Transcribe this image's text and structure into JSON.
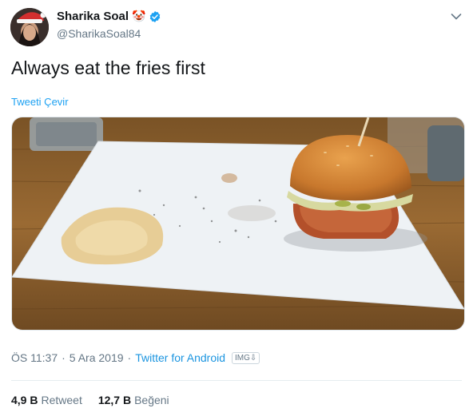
{
  "author": {
    "name": "Sharika Soal",
    "handle": "@SharikaSoal84",
    "emoji": "🤡",
    "verified_icon": "verified-badge-icon",
    "avatar_icon": "profile-photo-santa-hat"
  },
  "tweet": {
    "text": "Always eat the fries first",
    "translate_label": "Tweeti Çevir",
    "media_description_icon": "photo-burger-on-paper"
  },
  "meta": {
    "time": "ÖS 11:37",
    "separator": "·",
    "date": "5 Ara 2019",
    "source": "Twitter for Android",
    "img_badge": "IMG⇩"
  },
  "stats": {
    "retweet_count": "4,9 B",
    "retweet_label": "Retweet",
    "like_count": "12,7 B",
    "like_label": "Beğeni"
  },
  "colors": {
    "link": "#1da1f2",
    "secondary_text": "#657786",
    "primary_text": "#14171a"
  }
}
